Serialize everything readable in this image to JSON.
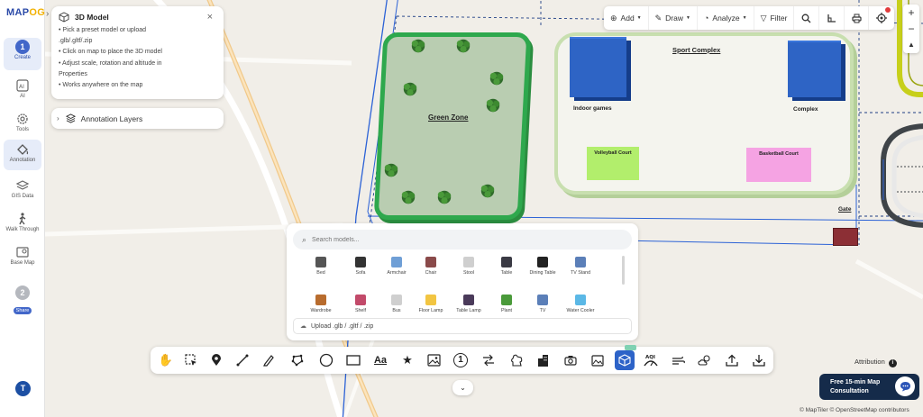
{
  "app": {
    "logo_prefix": "MAP",
    "logo_suffix": "OG"
  },
  "sidebar": {
    "items": [
      {
        "label": "Create",
        "step": "1"
      },
      {
        "label": "AI"
      },
      {
        "label": "Tools"
      },
      {
        "label": "Annotation"
      },
      {
        "label": "GIS Data"
      },
      {
        "label": "Walk Through"
      },
      {
        "label": "Base Map"
      },
      {
        "label": "Share",
        "step": "2"
      }
    ],
    "avatar": "T"
  },
  "info_panel": {
    "title": "3D Model",
    "lines": [
      "• Pick a preset model or upload",
      ".glb/.gltf/.zip",
      "• Click on map to place the 3D model",
      "• Adjust scale, rotation and altitude in",
      "Properties",
      "• Works anywhere on the map"
    ],
    "close_icon": "×"
  },
  "annotation_layers": {
    "label": "Annotation Layers"
  },
  "top_toolbar": {
    "add": "Add",
    "draw": "Draw",
    "analyze": "Analyze",
    "filter": "Filter"
  },
  "zoom": {
    "in": "+",
    "out": "−",
    "compass": "▲"
  },
  "map": {
    "green_zone": "Green Zone",
    "sport_complex": "Sport Complex",
    "indoor_games": "Indoor games",
    "complex": "Complex",
    "volleyball": "Volleyball Court",
    "basketball": "Basketball Court",
    "gate": "Gate"
  },
  "picker": {
    "search_placeholder": "Search models...",
    "upload_label": "Upload .glb / .gltf / .zip",
    "models": [
      {
        "name": "Bed",
        "color": "#555555"
      },
      {
        "name": "Sofa",
        "color": "#333333"
      },
      {
        "name": "Armchair",
        "color": "#6f9fd6"
      },
      {
        "name": "Chair",
        "color": "#8a4a4a"
      },
      {
        "name": "Stool",
        "color": "#cfcfcf"
      },
      {
        "name": "Table",
        "color": "#3a3a44"
      },
      {
        "name": "Dining Table",
        "color": "#222222"
      },
      {
        "name": "TV Stand",
        "color": "#5b7fb8"
      },
      {
        "name": "Wardrobe",
        "color": "#b86c2e"
      },
      {
        "name": "Shelf",
        "color": "#c24a6a"
      },
      {
        "name": "Bus",
        "color": "#cfcfcf"
      },
      {
        "name": "Floor Lamp",
        "color": "#f2c542"
      },
      {
        "name": "Table Lamp",
        "color": "#4a3a5a"
      },
      {
        "name": "Plant",
        "color": "#4a9a3a"
      },
      {
        "name": "TV",
        "color": "#5b7fb8"
      },
      {
        "name": "Water Cooler",
        "color": "#5bb8e6"
      }
    ]
  },
  "bottom_toolbar": {
    "tools": [
      "hand-icon",
      "select-icon",
      "pin-icon",
      "line-icon",
      "pen-icon",
      "polygon-icon",
      "circle-icon",
      "rectangle-icon",
      "text-icon",
      "star-icon",
      "image-icon",
      "number-icon",
      "route-icon",
      "puzzle-icon",
      "building-icon",
      "camera-icon",
      "photo-icon",
      "cube-icon",
      "aqi-icon",
      "wind-icon",
      "weather-icon",
      "upload-icon",
      "download-icon"
    ],
    "aqi_label": "AQI",
    "text_label": "Aa",
    "number_label": "1"
  },
  "attribution": {
    "label": "Attribution",
    "info": "i"
  },
  "consult": {
    "line1": "Free 15-min Map",
    "line2": "Consultation"
  },
  "copyright": "© MapTiler © OpenStreetMap contributors",
  "colors": {
    "accent": "#2d63c8",
    "green_zone_border": "#2ea84d",
    "building": "#2e64c5"
  }
}
